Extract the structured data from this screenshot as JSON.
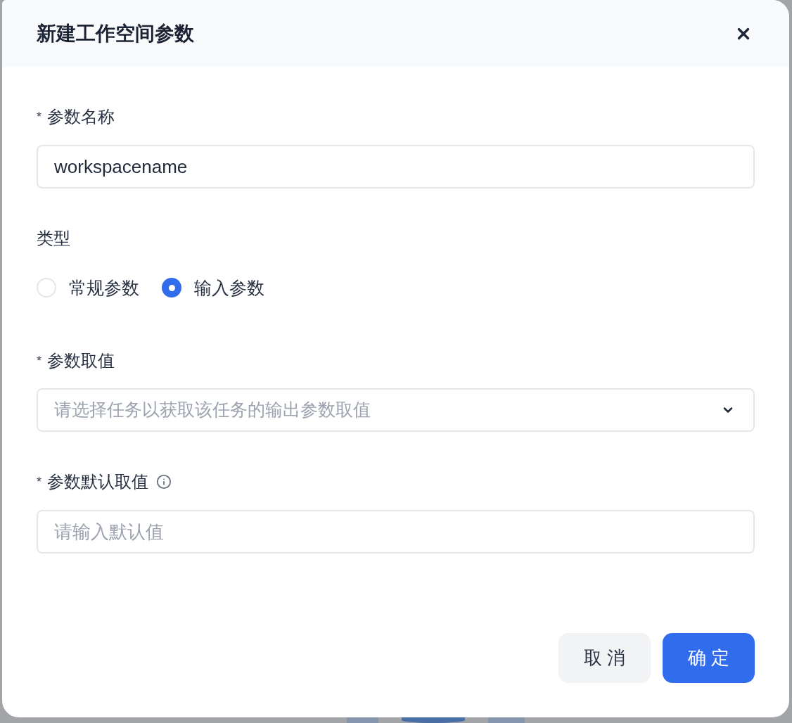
{
  "dialog": {
    "title": "新建工作空间参数"
  },
  "fields": [
    {
      "kind": "text",
      "required_mark": "*",
      "label": "参数名称",
      "value": "workspacename"
    },
    {
      "kind": "radio",
      "label": "类型",
      "options": [
        {
          "label": "常规参数",
          "selected": false
        },
        {
          "label": "输入参数",
          "selected": true
        }
      ]
    },
    {
      "kind": "select",
      "required_mark": "*",
      "label": "参数取值",
      "placeholder": "请选择任务以获取该任务的输出参数取值"
    },
    {
      "kind": "text",
      "required_mark": "*",
      "label": "参数默认取值",
      "info": true,
      "placeholder": "请输入默认值"
    }
  ],
  "buttons": [
    {
      "label": "取 消",
      "kind": "secondary"
    },
    {
      "label": "确 定",
      "kind": "primary"
    }
  ]
}
